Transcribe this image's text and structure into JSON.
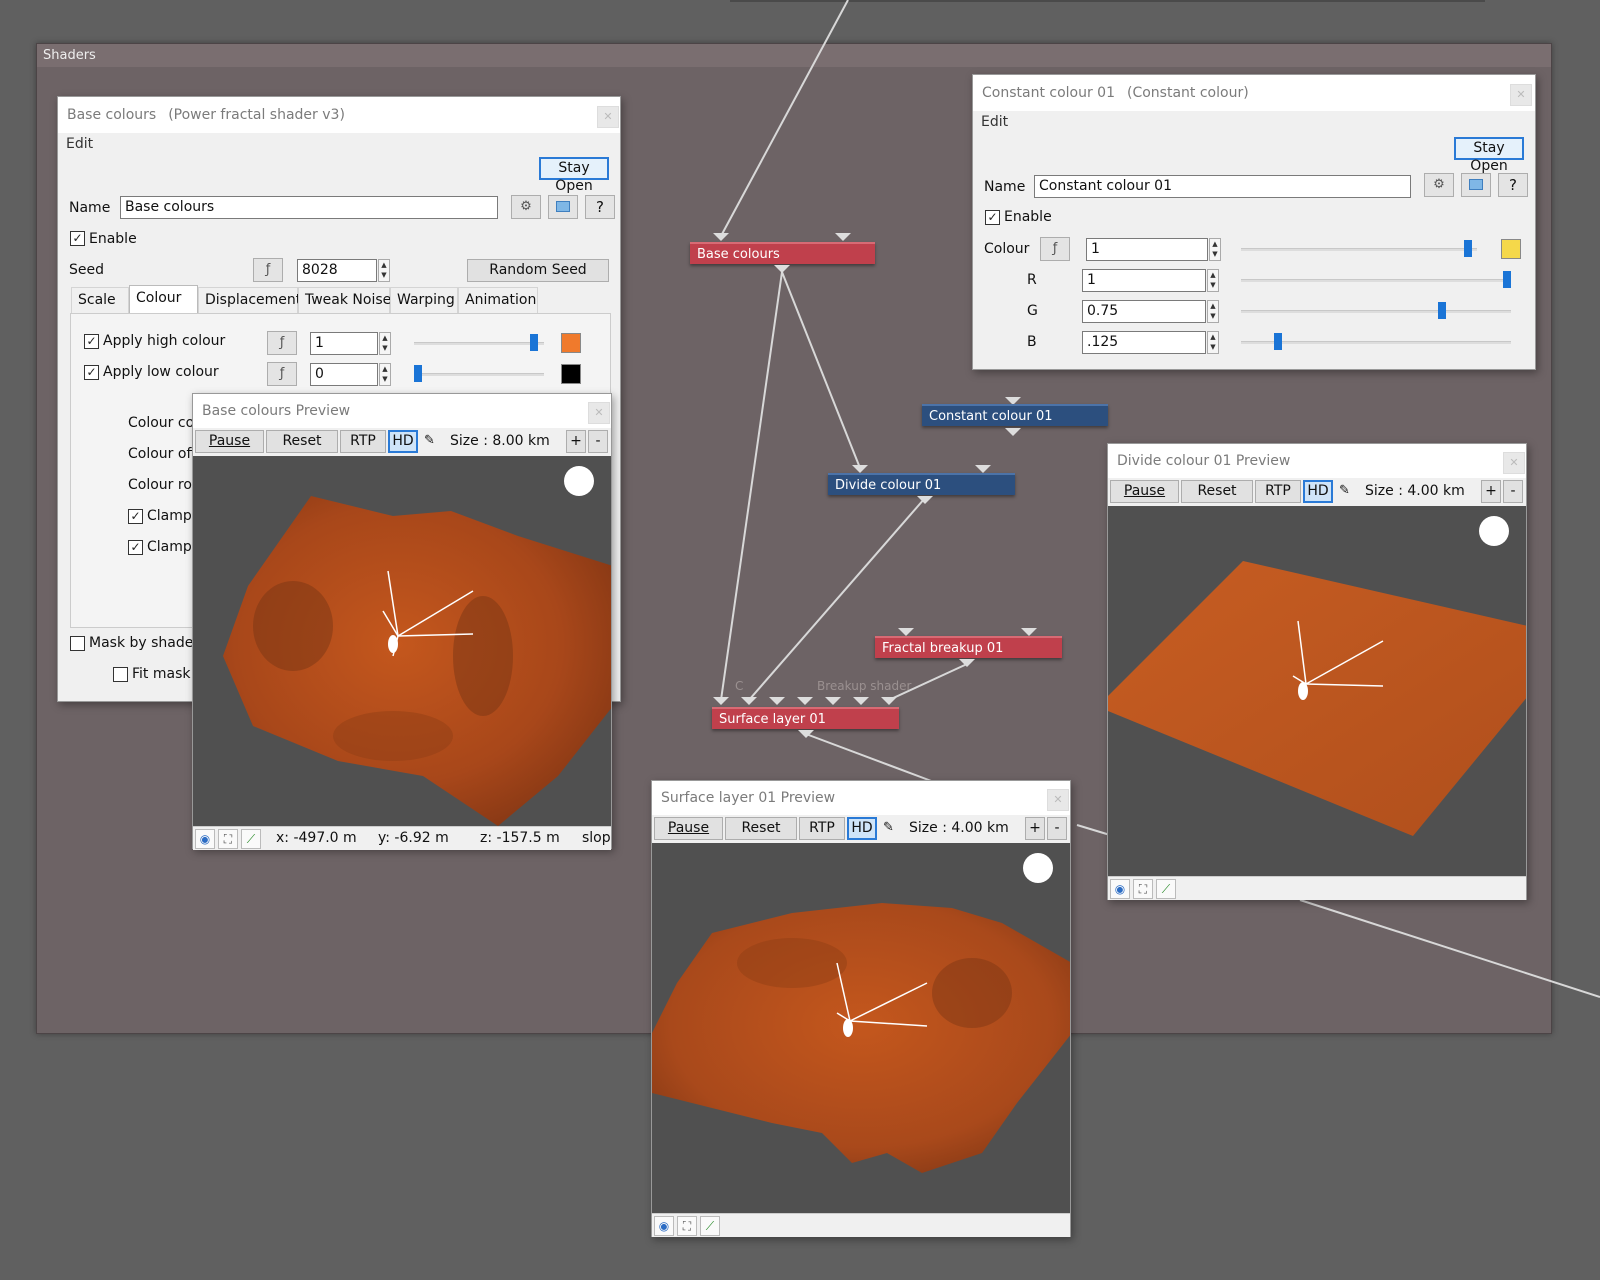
{
  "group": {
    "title": "Shaders"
  },
  "nodes": {
    "base_colours": "Base colours",
    "constant_colour": "Constant colour 01",
    "divide_colour": "Divide colour 01",
    "fractal_breakup": "Fractal breakup 01",
    "surface_layer": "Surface layer 01",
    "surface_input_c": "C",
    "surface_input_breakup": "Breakup shader"
  },
  "base_window": {
    "title": "Base colours",
    "subtitle": "(Power fractal shader v3)",
    "menu": "Edit",
    "stay_open": "Stay Open",
    "name_label": "Name",
    "name_value": "Base colours",
    "help": "?",
    "enable_label": "Enable",
    "seed_label": "Seed",
    "seed_value": "8028",
    "random_seed": "Random Seed",
    "tabs": [
      "Scale",
      "Colour",
      "Displacement",
      "Tweak Noise",
      "Warping",
      "Animation"
    ],
    "active_tab": "Colour",
    "apply_high_label": "Apply high colour",
    "apply_high_value": "1",
    "apply_high_level": 0.95,
    "high_colour": "#f07a2c",
    "apply_low_label": "Apply low colour",
    "apply_low_value": "0",
    "apply_low_level": 0.0,
    "low_colour": "#000000",
    "partial_labels": [
      "Colour co",
      "Colour off",
      "Colour rou",
      "Clamp",
      "Clamp"
    ],
    "mask_label": "Mask by shader",
    "fit_mask_label": "Fit mask t"
  },
  "base_preview": {
    "title": "Base colours Preview",
    "pause": "Pause",
    "reset": "Reset",
    "rtp": "RTP",
    "hd": "HD",
    "size": "Size : 8.00 km",
    "plus": "+",
    "minus": "-",
    "x": "x: -497.0 m",
    "y": "y: -6.92 m",
    "z": "z: -157.5 m",
    "slope": "slope"
  },
  "constant_window": {
    "title": "Constant colour 01",
    "subtitle": "(Constant colour)",
    "menu": "Edit",
    "stay_open": "Stay Open",
    "name_label": "Name",
    "name_value": "Constant colour 01",
    "help": "?",
    "enable_label": "Enable",
    "colour_label": "Colour",
    "colour_value": "1",
    "colour_level": 0.98,
    "colour_swatch": "#f5d84a",
    "r_label": "R",
    "r_value": "1",
    "r_level": 1.0,
    "g_label": "G",
    "g_value": "0.75",
    "g_level": 0.75,
    "b_label": "B",
    "b_value": ".125",
    "b_level": 0.125
  },
  "divide_preview": {
    "title": "Divide colour 01 Preview",
    "pause": "Pause",
    "reset": "Reset",
    "rtp": "RTP",
    "hd": "HD",
    "size": "Size : 4.00 km",
    "plus": "+",
    "minus": "-"
  },
  "surface_preview": {
    "title": "Surface layer 01 Preview",
    "pause": "Pause",
    "reset": "Reset",
    "rtp": "RTP",
    "hd": "HD",
    "size": "Size : 4.00 km",
    "plus": "+",
    "minus": "-"
  },
  "icons": [
    "gear-icon",
    "preview-icon",
    "function-icon",
    "eye-icon",
    "frame-icon",
    "curve-icon",
    "compass-icon",
    "brush-icon"
  ]
}
